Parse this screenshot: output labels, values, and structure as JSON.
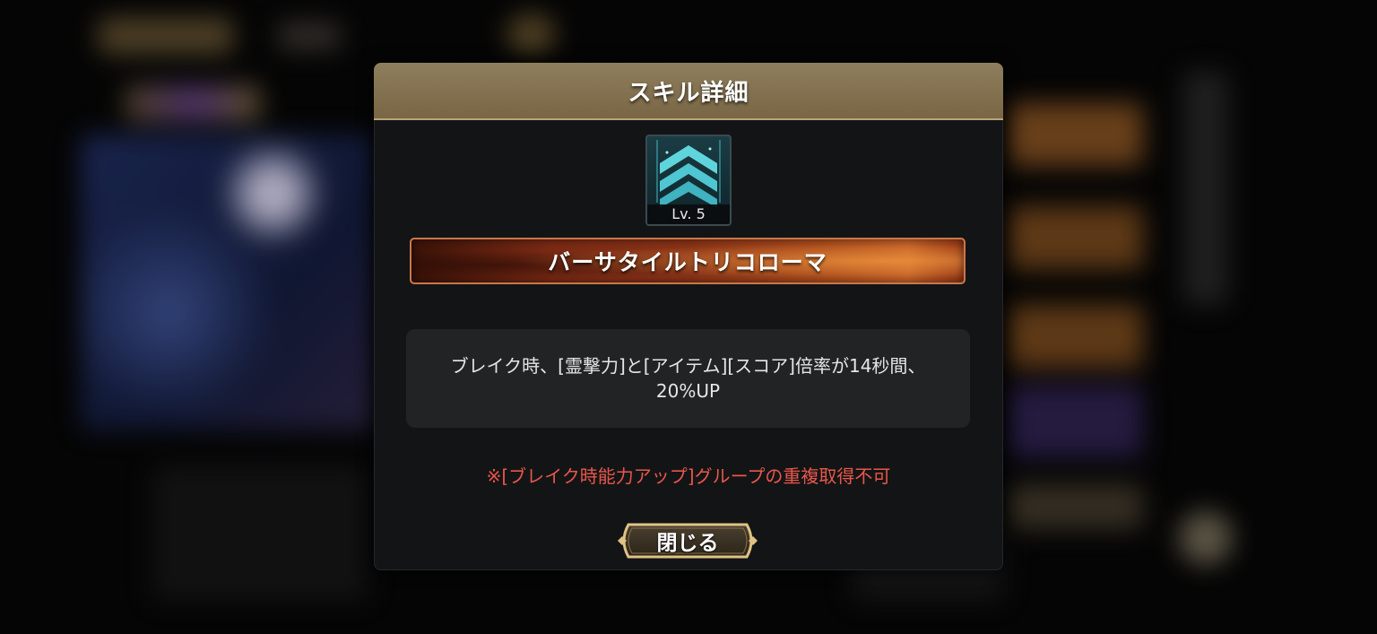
{
  "dialog": {
    "title": "スキル詳細",
    "skill": {
      "icon": "teal-chevron-up-icon",
      "level": "Lv. 5",
      "name": "バーサタイルトリコローマ",
      "description_line1": "ブレイク時、[霊撃力]と[アイテム][スコア]倍率が14秒間、",
      "description_line2": "20%UP"
    },
    "note": "※[ブレイク時能力アップ]グループの重複取得不可",
    "close_label": "閉じる"
  },
  "colors": {
    "header": "#8a7856",
    "note": "#e8574a",
    "banner_accent": "#c8652a",
    "icon_teal": "#4fc7d2",
    "button_gold": "#d9b776"
  }
}
